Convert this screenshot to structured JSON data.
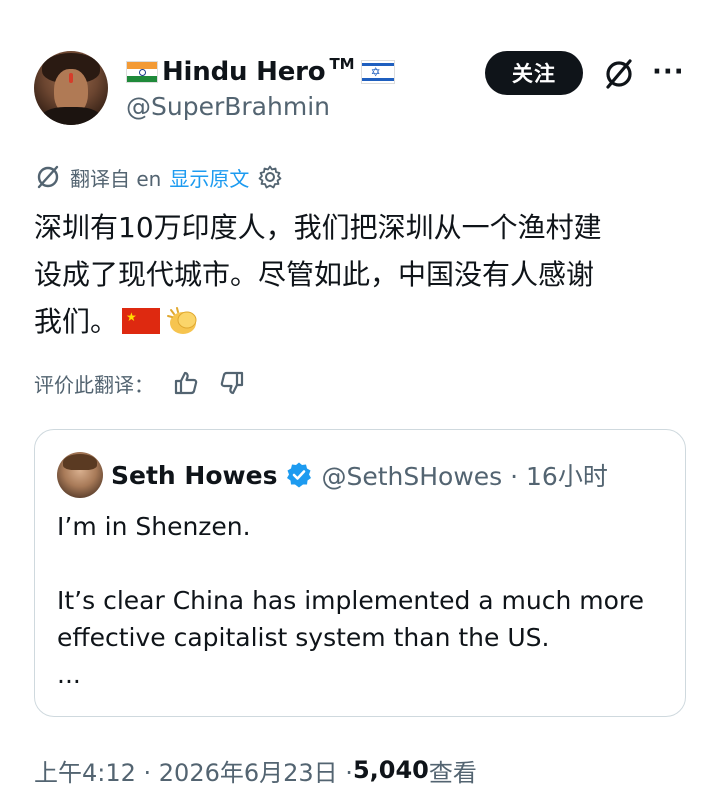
{
  "author": {
    "display_name": "Hindu Hero",
    "tm": "TM",
    "handle": "@SuperBrahmin",
    "flag_left": "india-flag",
    "flag_right": "israel-flag"
  },
  "actions": {
    "follow_label": "关注",
    "grok_icon": "grok-icon",
    "more_icon": "more-icon",
    "more_text": "···"
  },
  "translation": {
    "translated_from": "翻译自 en",
    "show_original": "显示原文"
  },
  "tweet": {
    "text": "深圳有10万印度人，我们把深圳从一个渔村建\n设成了现代城市。尽管如此，中国没有人感谢\n我们。",
    "emojis": [
      "china-flag",
      "clapping-hands"
    ]
  },
  "rate_translation": {
    "label": "评价此翻译："
  },
  "quoted_tweet": {
    "name": "Seth Howes",
    "handle_time": "@SethSHowes · 16小时",
    "line1": "I’m in Shenzen.",
    "line2": "It’s clear China has implemented a much more effective capitalist system than the US.",
    "ellipsis": "..."
  },
  "meta": {
    "time_date": "上午4:12 · 2026年6月23日 · ",
    "views_count": "5,040",
    "views_label": " 查看"
  },
  "colors": {
    "text": "#0f1419",
    "secondary": "#536471",
    "link": "#1d9bf0",
    "border": "#cfd9de",
    "verified": "#1d9bf0"
  }
}
